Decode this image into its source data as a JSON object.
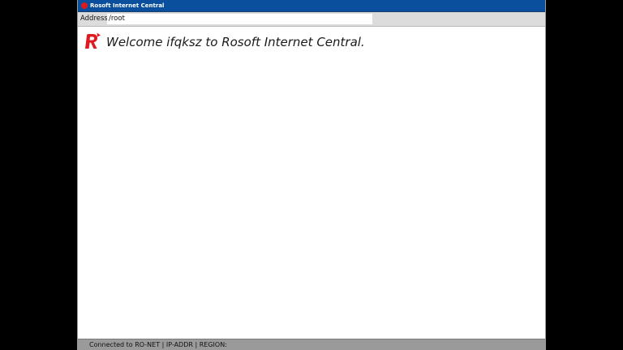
{
  "window": {
    "title": "Rosoft Internet Central",
    "title_bar_color": "#0a4f9e",
    "title_icon": "rosoft-logo-icon"
  },
  "address_bar": {
    "label": "Address:",
    "value": "/root"
  },
  "content": {
    "logo_icon": "rosoft-r-logo-icon",
    "logo_color": "#e0191f",
    "welcome_text": "Welcome ifqksz to Rosoft Internet Central."
  },
  "status_bar": {
    "text": "Connected to RO-NET | IP-ADDR | REGION:"
  }
}
